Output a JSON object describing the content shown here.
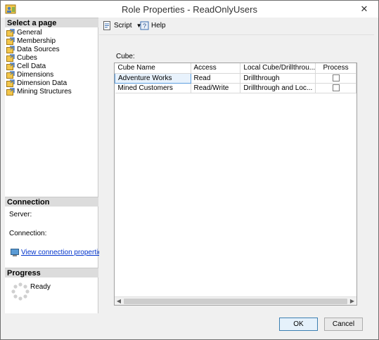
{
  "window": {
    "title": "Role Properties - ReadOnlyUsers",
    "close_glyph": "✕"
  },
  "left": {
    "select_page_header": "Select a page",
    "pages": [
      {
        "label": "General"
      },
      {
        "label": "Membership"
      },
      {
        "label": "Data Sources"
      },
      {
        "label": "Cubes"
      },
      {
        "label": "Cell Data"
      },
      {
        "label": "Dimensions"
      },
      {
        "label": "Dimension Data"
      },
      {
        "label": "Mining Structures"
      }
    ],
    "connection_header": "Connection",
    "server_label": "Server:",
    "connection_label": "Connection:",
    "view_conn_link": "View connection properties",
    "progress_header": "Progress",
    "progress_status": "Ready"
  },
  "toolbar": {
    "script_label": "Script",
    "help_label": "Help"
  },
  "main": {
    "cube_label": "Cube:",
    "columns": [
      "Cube Name",
      "Access",
      "Local Cube/Drillthrou...",
      "Process"
    ],
    "rows": [
      {
        "cube_name": "Adventure Works",
        "access": "Read",
        "local_cube": "Drillthrough",
        "process": false
      },
      {
        "cube_name": "Mined Customers",
        "access": "Read/Write",
        "local_cube": "Drillthrough and Loc...",
        "process": false
      }
    ]
  },
  "buttons": {
    "ok": "OK",
    "cancel": "Cancel"
  },
  "colors": {
    "link": "#0033cc",
    "selection_border": "#5ea0e0",
    "header_bg": "#dcdcdc"
  }
}
